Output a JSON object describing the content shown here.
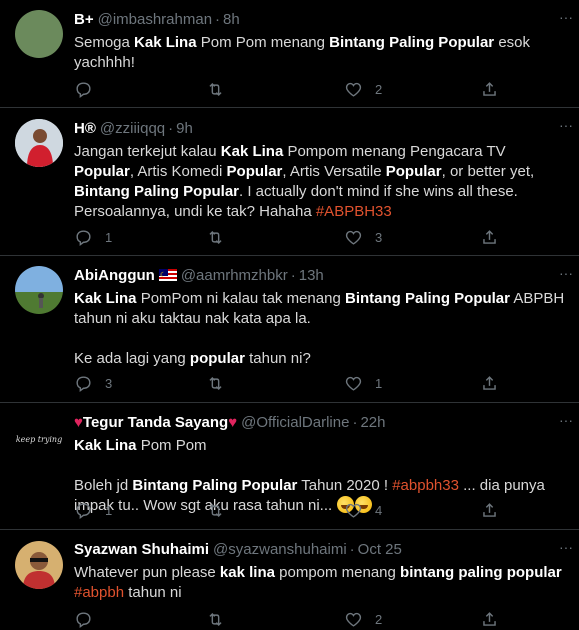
{
  "tweets": [
    {
      "name": "B+",
      "handle": "@imbashrahman",
      "time": "8h",
      "body": [
        [
          {
            "t": "Semoga "
          },
          {
            "t": "Kak Lina",
            "s": "b"
          },
          {
            "t": " Pom Pom menang "
          },
          {
            "t": "Bintang Paling Popular",
            "s": "b"
          },
          {
            "t": " esok yachhhh!"
          }
        ]
      ],
      "replies": "",
      "likes": "2",
      "avatar_color": "#6b8a5c"
    },
    {
      "name": "H®",
      "handle": "@zziiiqqq",
      "time": "9h",
      "body": [
        [
          {
            "t": "Jangan terkejut kalau "
          },
          {
            "t": "Kak Lina",
            "s": "b"
          },
          {
            "t": " Pompom menang Pengacara TV "
          },
          {
            "t": "Popular",
            "s": "b"
          },
          {
            "t": ", Artis Komedi "
          },
          {
            "t": "Popular",
            "s": "b"
          },
          {
            "t": ", Artis Versatile "
          },
          {
            "t": "Popular",
            "s": "b"
          },
          {
            "t": ", or better yet, "
          },
          {
            "t": "Bintang Paling Popular",
            "s": "b"
          },
          {
            "t": ". I actually don't mind if she wins all these. Persoalannya, undi ke tak? Hahaha "
          },
          {
            "t": "#ABPBH33",
            "s": "tag"
          }
        ]
      ],
      "replies": "1",
      "likes": "3",
      "avatar_color": "#c9d3dc"
    },
    {
      "name": "AbiAnggun",
      "handle": "@aamrhmzhbkr",
      "time": "13h",
      "body": [
        [
          {
            "t": "Kak Lina",
            "s": "b"
          },
          {
            "t": " PomPom ni kalau tak menang "
          },
          {
            "t": "Bintang Paling Popular",
            "s": "b"
          },
          {
            "t": " ABPBH tahun ni aku taktau nak kata apa la."
          }
        ],
        [
          {
            "t": "Ke ada lagi yang "
          },
          {
            "t": "popular",
            "s": "b"
          },
          {
            "t": " tahun ni?"
          }
        ]
      ],
      "replies": "3",
      "likes": "1",
      "avatar_color": "#5c7a3c"
    },
    {
      "name": "Tegur Tanda Sayang",
      "handle": "@OfficialDarline",
      "time": "22h",
      "avatar_text": "keep trying",
      "body": [
        [
          {
            "t": "Kak Lina",
            "s": "b"
          },
          {
            "t": " Pom Pom"
          }
        ],
        [
          {
            "t": "Boleh jd "
          },
          {
            "t": "Bintang Paling Popular",
            "s": "b"
          },
          {
            "t": " Tahun 2020 ! "
          },
          {
            "t": "#abpbh33",
            "s": "tag"
          },
          {
            "t": "  ...  dia punya impak tu.. Wow sgt aku rasa tahun ni... "
          }
        ]
      ],
      "replies": "1",
      "likes": "4",
      "avatar_color": "#000000"
    },
    {
      "name": "Syazwan Shuhaimi",
      "handle": "@syazwanshuhaimi",
      "time": "Oct 25",
      "body": [
        [
          {
            "t": "Whatever pun please "
          },
          {
            "t": "kak lina",
            "s": "b"
          },
          {
            "t": " pompom menang "
          },
          {
            "t": "bintang paling popular",
            "s": "b"
          },
          {
            "t": " "
          },
          {
            "t": "#abpbh",
            "s": "tag"
          },
          {
            "t": " tahun ni"
          }
        ]
      ],
      "replies": "",
      "likes": "2",
      "avatar_color": "#c8a060"
    }
  ],
  "icons": {
    "reply": "reply-icon",
    "retweet": "retweet-icon",
    "like": "like-icon",
    "share": "share-icon",
    "more": "more-icon"
  },
  "colors": {
    "background": "#000000",
    "hashtag": "#e0522e",
    "secondary_text": "#6e767d",
    "divider": "#2f3336"
  }
}
